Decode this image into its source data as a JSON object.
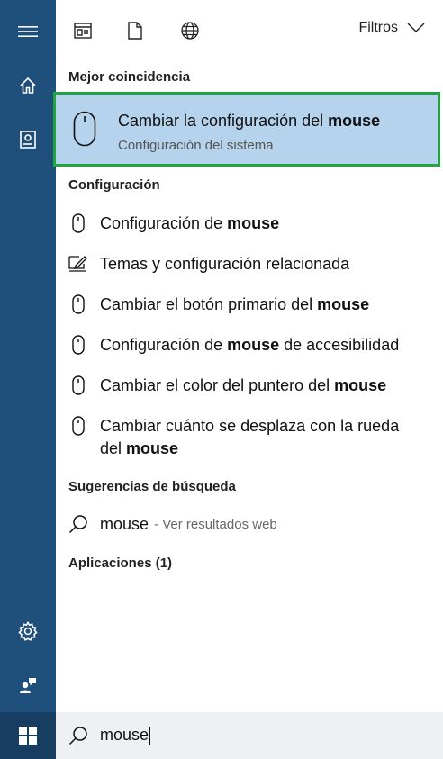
{
  "rail": {
    "icons": [
      "hamburger-menu-icon",
      "home-icon",
      "notebook-icon",
      "settings-gear-icon",
      "feedback-icon",
      "windows-start-icon"
    ]
  },
  "toolbar": {
    "icons": [
      "apps-filter-icon",
      "documents-filter-icon",
      "web-filter-icon"
    ],
    "filters_label": "Filtros"
  },
  "best_match": {
    "header": "Mejor coincidencia",
    "title_prefix": "Cambiar la configuración del ",
    "title_bold": "mouse",
    "subtitle": "Configuración del sistema",
    "highlight_border": "#1fa640",
    "highlight_bg": "#b5d3ec"
  },
  "settings": {
    "header": "Configuración",
    "items": [
      {
        "icon": "mouse-icon",
        "pre": "Configuración de ",
        "bold": "mouse",
        "post": ""
      },
      {
        "icon": "theme-settings-icon",
        "pre": "Temas y configuración relacionada",
        "bold": "",
        "post": ""
      },
      {
        "icon": "mouse-icon",
        "pre": "Cambiar el botón primario del ",
        "bold": "mouse",
        "post": ""
      },
      {
        "icon": "mouse-icon",
        "pre": "Configuración de ",
        "bold": "mouse",
        "post": " de accesibilidad"
      },
      {
        "icon": "mouse-icon",
        "pre": "Cambiar el color del puntero del ",
        "bold": "mouse",
        "post": ""
      },
      {
        "icon": "mouse-icon",
        "pre": "Cambiar cuánto se desplaza con la rueda del ",
        "bold": "mouse",
        "post": ""
      }
    ]
  },
  "suggestions": {
    "header": "Sugerencias de búsqueda",
    "term": "mouse",
    "hint": "- Ver resultados web"
  },
  "apps": {
    "header": "Aplicaciones (1)"
  },
  "search": {
    "value": "mouse"
  },
  "colors": {
    "rail": "#1f4f7b",
    "accent": "#1fa640"
  }
}
